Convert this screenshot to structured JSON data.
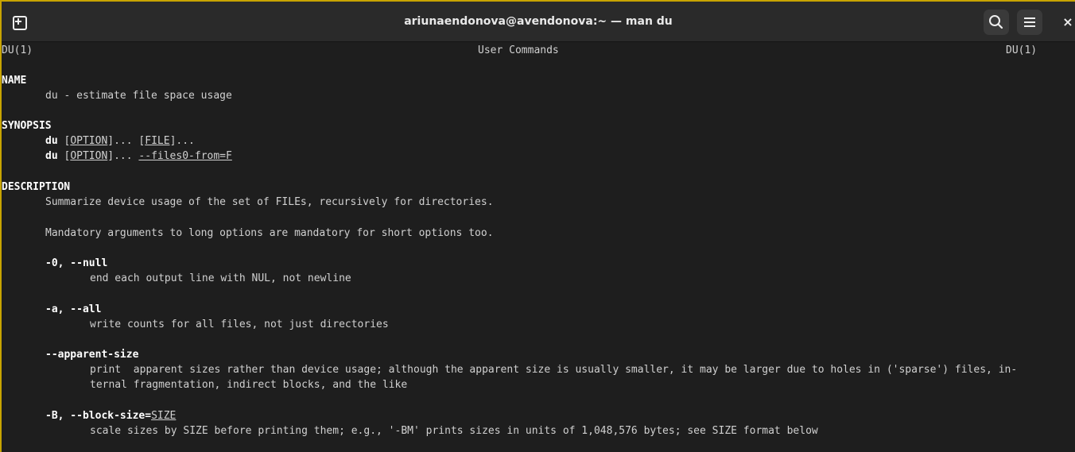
{
  "window": {
    "title": "ariunaendonova@avendonova:~ — man du",
    "new_tab_label": "+",
    "close_label": "×"
  },
  "man": {
    "header_left": "DU(1)",
    "header_center": "User Commands",
    "header_right": "DU(1)",
    "name_heading": "NAME",
    "name_text": "du - estimate file space usage",
    "synopsis_heading": "SYNOPSIS",
    "synopsis_cmd": "du",
    "synopsis_option": "OPTION",
    "synopsis_file": "FILE",
    "synopsis_files0": "--files0-from=F",
    "description_heading": "DESCRIPTION",
    "description_1": "Summarize device usage of the set of FILEs, recursively for directories.",
    "description_2": "Mandatory arguments to long options are mandatory for short options too.",
    "opt_null_name": "-0, --null",
    "opt_null_desc": "end each output line with NUL, not newline",
    "opt_all_name": "-a, --all",
    "opt_all_desc": "write counts for all files, not just directories",
    "opt_apparent_name": "--apparent-size",
    "opt_apparent_desc_1": "print  apparent sizes rather than device usage; although the apparent size is usually smaller, it may be larger due to holes in ('sparse') files, in-",
    "opt_apparent_desc_2": "ternal fragmentation, indirect blocks, and the like",
    "opt_block_name": "-B, --block-size=",
    "opt_block_arg": "SIZE",
    "opt_block_desc": "scale sizes by SIZE before printing them; e.g., '-BM' prints sizes in units of 1,048,576 bytes; see SIZE format below"
  }
}
